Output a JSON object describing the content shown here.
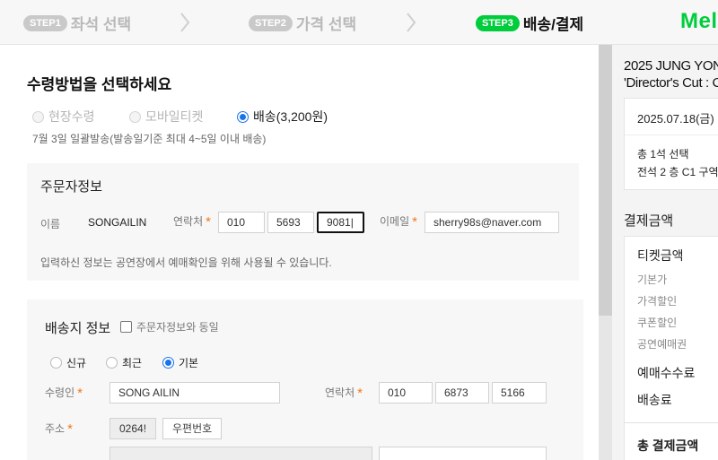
{
  "steps": [
    {
      "badge": "STEP1",
      "label": "좌석 선택",
      "active": false
    },
    {
      "badge": "STEP2",
      "label": "가격 선택",
      "active": false
    },
    {
      "badge": "STEP3",
      "label": "배송/결제",
      "active": true
    }
  ],
  "brand": "Mel",
  "delivery": {
    "title": "수령방법을 선택하세요",
    "options": [
      "현장수령",
      "모바일티켓",
      "배송(3,200원)"
    ],
    "selected": "배송(3,200원)",
    "note": "7월 3일 일괄발송(발송일기준 최대 4~5일 이내 배송)"
  },
  "orderer": {
    "title": "주문자정보",
    "name_label": "이름",
    "name_value": "SONGAILIN",
    "phone_label": "연락처",
    "phone": [
      "010",
      "5693",
      "9081|"
    ],
    "email_label": "이메일",
    "email": "sherry98s@naver.com",
    "info": "입력하신 정보는 공연장에서 예매확인을 위해 사용될 수 있습니다."
  },
  "shipping": {
    "title": "배송지 정보",
    "same_as_orderer": "주문자정보와 동일",
    "address_types": [
      "신규",
      "최근",
      "기본"
    ],
    "selected_type": "기본",
    "receiver_label": "수령인",
    "receiver": "SONG AILIN",
    "phone_label": "연락처",
    "phone": [
      "010",
      "6873",
      "5166"
    ],
    "address_label": "주소",
    "zip": "0264!",
    "zip_button": "우편번호"
  },
  "sidebar": {
    "title_line1": "2025 JUNG YON",
    "title_line2": "'Director's Cut : C",
    "date": "2025.07.18(금)",
    "count": "총 1석 선택",
    "seat": "전석 2 층 C1 구역",
    "payment_title": "결제금액",
    "ticket_label": "티켓금액",
    "sub_items": [
      "기본가",
      "가격할인",
      "쿠폰할인",
      "공연예매권"
    ],
    "fee_label": "예매수수료",
    "shipping_label": "배송료",
    "total_label": "총 결제금액"
  },
  "colors": {
    "accent": "#00cd3c",
    "required": "#f07a1e",
    "radio": "#1a73e8"
  }
}
